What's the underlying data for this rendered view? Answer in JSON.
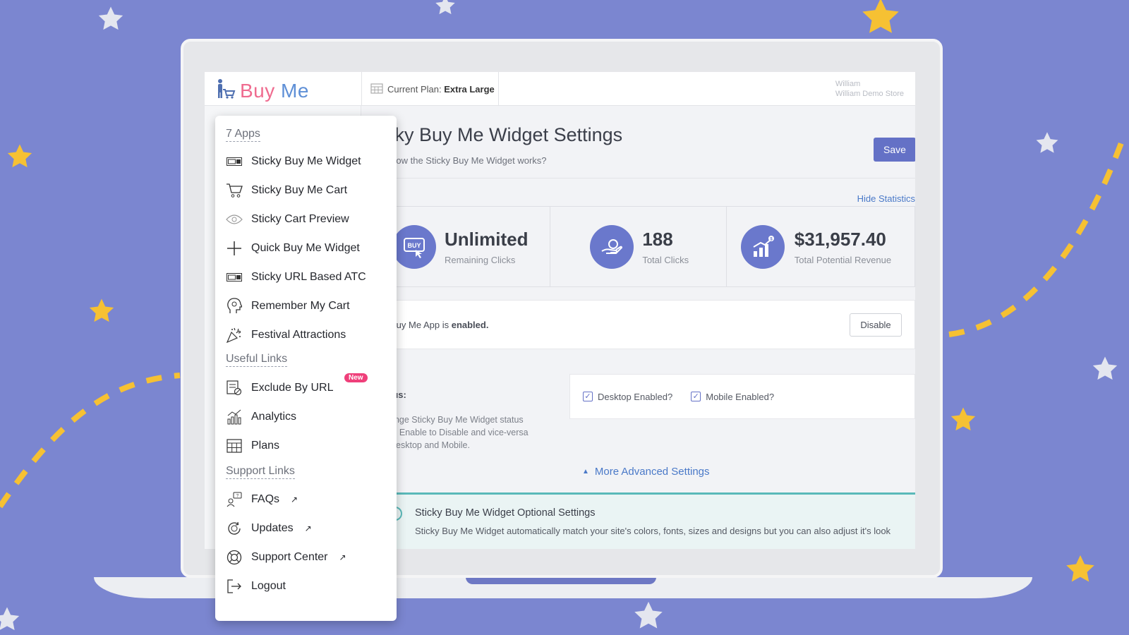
{
  "colors": {
    "background": "#7b86d0",
    "accent": "#6471c6",
    "brand_pink": "#ef6b8f",
    "brand_blue": "#5e8fd6",
    "star_gold": "#f6c133"
  },
  "header": {
    "logo_part1": "Buy ",
    "logo_part2": "Me",
    "plan_label": "Current Plan:",
    "plan_value": "Extra Large",
    "user_name": "William",
    "store_name": "William Demo Store"
  },
  "main": {
    "title": "icky Buy Me Widget Settings",
    "subtitle": "How the Sticky Buy Me Widget works?",
    "save_label": "Save",
    "hide_stats_label": "Hide Statistics",
    "stats": [
      {
        "value": "Unlimited",
        "label": "Remaining Clicks",
        "icon": "buy-icon"
      },
      {
        "value": "188",
        "label": "Total Clicks",
        "icon": "hand-coin-icon"
      },
      {
        "value": "$31,957.40",
        "label": "Total Potential Revenue",
        "icon": "revenue-chart-icon"
      }
    ],
    "enabled_prefix": "Buy Me App is ",
    "enabled_state": "enabled.",
    "disable_label": "Disable",
    "status_label": "tus:",
    "status_desc_1": "ange Sticky Buy Me Widget status",
    "status_desc_2": "m Enable to Disable and vice-versa",
    "status_desc_3": "Desktop and Mobile.",
    "desktop_label": "Desktop Enabled?",
    "mobile_label": "Mobile Enabled?",
    "desktop_checked": true,
    "mobile_checked": true,
    "more_advanced_label": "More Advanced Settings",
    "optional_title": "Sticky Buy Me Widget Optional Settings",
    "optional_desc": "Sticky Buy Me Widget automatically match your site's colors, fonts, sizes and designs but you can also adjust it's look"
  },
  "menu": {
    "apps_heading": "7 Apps",
    "apps": [
      {
        "label": "Sticky Buy Me Widget",
        "icon": "widget-icon"
      },
      {
        "label": "Sticky Buy Me Cart",
        "icon": "cart-icon"
      },
      {
        "label": "Sticky Cart Preview",
        "icon": "eye-icon"
      },
      {
        "label": "Quick Buy Me Widget",
        "icon": "plus-icon"
      },
      {
        "label": "Sticky URL Based ATC",
        "icon": "url-widget-icon"
      },
      {
        "label": "Remember My Cart",
        "icon": "head-icon"
      },
      {
        "label": "Festival Attractions",
        "icon": "confetti-icon"
      }
    ],
    "useful_heading": "Useful Links",
    "useful": [
      {
        "label": "Exclude By URL",
        "icon": "exclude-url-icon",
        "badge": "New"
      },
      {
        "label": "Analytics",
        "icon": "analytics-icon"
      },
      {
        "label": "Plans",
        "icon": "plans-icon"
      }
    ],
    "support_heading": "Support Links",
    "support": [
      {
        "label": "FAQs",
        "icon": "faq-icon"
      },
      {
        "label": "Updates",
        "icon": "updates-icon"
      },
      {
        "label": "Support Center",
        "icon": "support-icon"
      },
      {
        "label": "Logout",
        "icon": "logout-icon"
      }
    ]
  }
}
